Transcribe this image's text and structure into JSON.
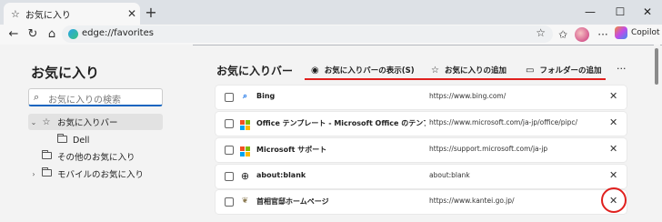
{
  "tab": {
    "title": "お気に入り",
    "close": "✕",
    "new_tab": "+"
  },
  "window": {
    "minimize": "—",
    "maximize": "☐",
    "close": "✕"
  },
  "toolbar": {
    "back": "←",
    "refresh": "↻",
    "home": "⌂",
    "address": "edge://favorites",
    "more": "···",
    "copilot_label": "Copilot"
  },
  "sidebar": {
    "title": "お気に入り",
    "search_placeholder": "お気に入りの検索",
    "items": [
      {
        "label": "お気に入りバー",
        "chevron": "⌄"
      },
      {
        "label": "Dell"
      },
      {
        "label": "その他のお気に入り"
      },
      {
        "label": "モバイルのお気に入り",
        "chevron": "›"
      }
    ]
  },
  "main": {
    "title": "お気に入りバー",
    "commands": [
      {
        "label": "お気に入りバーの表示(S)"
      },
      {
        "label": "お気に入りの追加"
      },
      {
        "label": "フォルダーの追加"
      }
    ],
    "more": "···",
    "rows": [
      {
        "name": "Bing",
        "url": "https://www.bing.com/"
      },
      {
        "name": "Office テンプレート - Microsoft Office のテンプレート - ...",
        "url": "https://www.microsoft.com/ja-jp/office/pipc/"
      },
      {
        "name": "Microsoft サポート",
        "url": "https://support.microsoft.com/ja-jp"
      },
      {
        "name": "about:blank",
        "url": "about:blank"
      },
      {
        "name": "首相官邸ホームページ",
        "url": "https://www.kantei.go.jp/"
      }
    ],
    "delete_glyph": "✕"
  },
  "colors": {
    "accent": "#1565c0",
    "highlight_red": "#e0201e",
    "ms_red": "#f25022",
    "ms_green": "#7fba00",
    "ms_blue": "#00a4ef",
    "ms_yellow": "#ffb900"
  }
}
